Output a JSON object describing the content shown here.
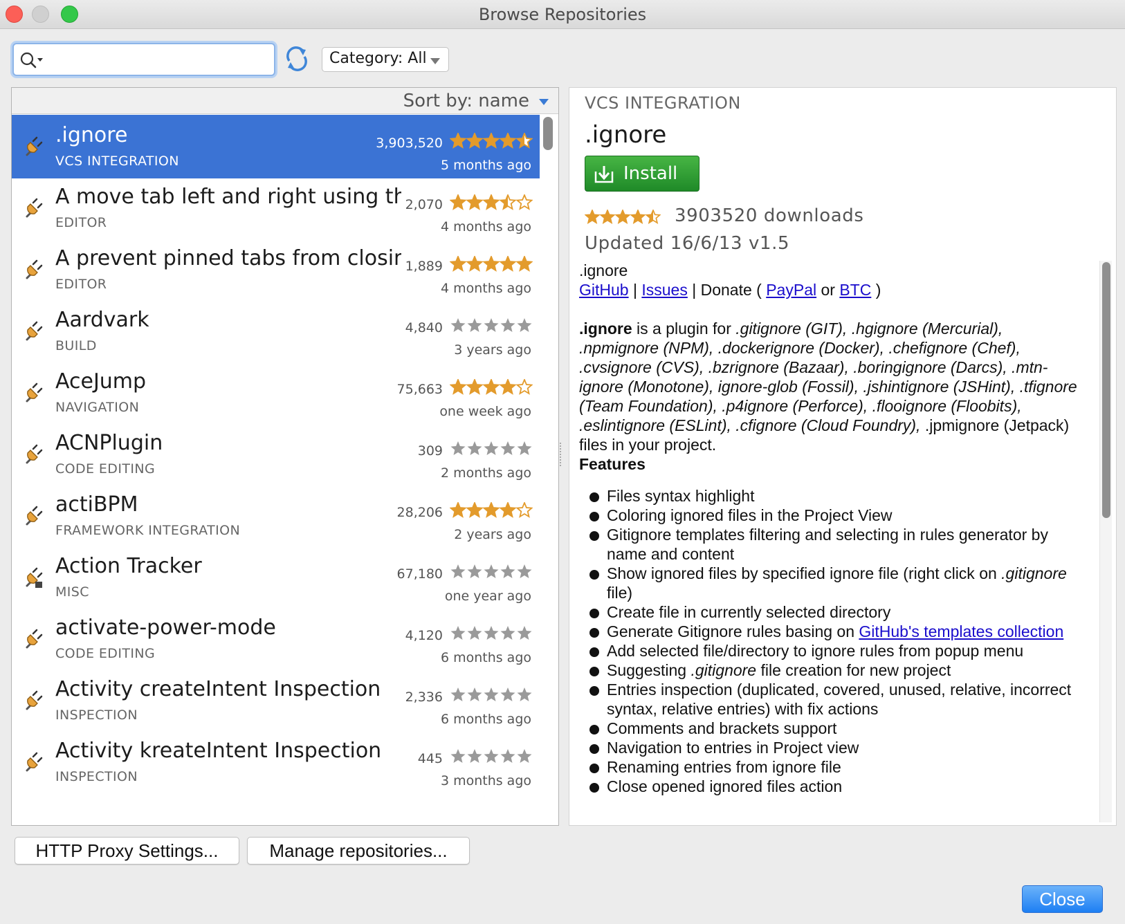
{
  "window": {
    "title": "Browse Repositories"
  },
  "search": {
    "value": "",
    "placeholder": ""
  },
  "category_filter": {
    "label": "Category: All"
  },
  "list": {
    "sort_label": "Sort by: name",
    "rows": [
      {
        "name": ".ignore",
        "category": "VCS INTEGRATION",
        "downloads": "3,903,520",
        "rating": 4.5,
        "date": "5 months ago",
        "selected": true,
        "icon": "plugin-icon"
      },
      {
        "name": "A move tab left and right using the keyboard",
        "category": "EDITOR",
        "downloads": "2,070",
        "rating": 3.5,
        "date": "4 months ago",
        "icon": "plugin-icon"
      },
      {
        "name": "A prevent pinned tabs from closing plugin",
        "category": "EDITOR",
        "downloads": "1,889",
        "rating": 5,
        "date": "4 months ago",
        "icon": "plugin-icon"
      },
      {
        "name": "Aardvark",
        "category": "BUILD",
        "downloads": "4,840",
        "rating": 0,
        "date": "3 years ago",
        "icon": "plugin-icon"
      },
      {
        "name": "AceJump",
        "category": "NAVIGATION",
        "downloads": "75,663",
        "rating": 4,
        "date": "one week ago",
        "icon": "plugin-icon"
      },
      {
        "name": "ACNPlugin",
        "category": "CODE EDITING",
        "downloads": "309",
        "rating": 0,
        "date": "2 months ago",
        "icon": "plugin-icon"
      },
      {
        "name": "actiBPM",
        "category": "FRAMEWORK INTEGRATION",
        "downloads": "28,206",
        "rating": 4,
        "date": "2 years ago",
        "icon": "plugin-icon"
      },
      {
        "name": "Action Tracker",
        "category": "MISC",
        "downloads": "67,180",
        "rating": 0,
        "date": "one year ago",
        "icon": "plugin-bundled-icon"
      },
      {
        "name": "activate-power-mode",
        "category": "CODE EDITING",
        "downloads": "4,120",
        "rating": 0,
        "date": "6 months ago",
        "icon": "plugin-icon"
      },
      {
        "name": "Activity createIntent Inspection",
        "category": "INSPECTION",
        "downloads": "2,336",
        "rating": 0,
        "date": "6 months ago",
        "icon": "plugin-icon"
      },
      {
        "name": "Activity kreateIntent Inspection",
        "category": "INSPECTION",
        "downloads": "445",
        "rating": 0,
        "date": "3 months ago",
        "icon": "plugin-icon"
      }
    ]
  },
  "detail": {
    "category": "VCS INTEGRATION",
    "name": ".ignore",
    "install_label": "Install",
    "rating": 4.5,
    "downloads": "3903520 downloads",
    "updated": "Updated 16/6/13   v1.5",
    "desc_title": ".ignore",
    "links": {
      "github": "GitHub",
      "sep1": " | ",
      "issues": "Issues",
      "donate": " | Donate ( ",
      "paypal": "PayPal",
      "or": " or ",
      "btc": "BTC",
      "close_paren": " )"
    },
    "intro_bold": ".ignore",
    "intro_text": " is a plugin for ",
    "intro_italic": ".gitignore (GIT), .hgignore (Mercurial), .npmignore (NPM), .dockerignore (Docker), .chefignore (Chef), .cvsignore (CVS), .bzrignore (Bazaar), .boringignore (Darcs), .mtn-ignore (Monotone), ignore-glob (Fossil), .jshintignore (JSHint), .tfignore (Team Foundation), .p4ignore (Perforce), .flooignore (Floobits), .eslintignore (ESLint), .cfignore (Cloud Foundry),",
    "intro_tail": " .jpmignore (Jetpack) files in your project.",
    "features_heading": "Features",
    "features": [
      "Files syntax highlight",
      "Coloring ignored files in the Project View",
      "Gitignore templates filtering and selecting in rules generator by name and content",
      "Show ignored files by specified ignore file (right click on ",
      "Create file in currently selected directory",
      "Generate Gitignore rules basing on ",
      "Add selected file/directory to ignore rules from popup menu",
      "Suggesting ",
      "Entries inspection (duplicated, covered, unused, relative, incorrect syntax, relative entries) with fix actions",
      "Comments and brackets support",
      "Navigation to entries in Project view",
      "Renaming entries from ignore file",
      "Close opened ignored files action"
    ],
    "feature_parts": {
      "gitignore_italic": ".gitignore",
      "file_close": " file)",
      "templates_link": "GitHub's templates collection",
      "suggest_tail": " file creation for new project"
    }
  },
  "buttons": {
    "proxy": "HTTP Proxy Settings...",
    "manage": "Manage repositories...",
    "close": "Close"
  },
  "colors": {
    "selection": "#3b73d4",
    "install": "#2f9a34",
    "star": "#e39b2c",
    "link": "#1a0dcc"
  }
}
